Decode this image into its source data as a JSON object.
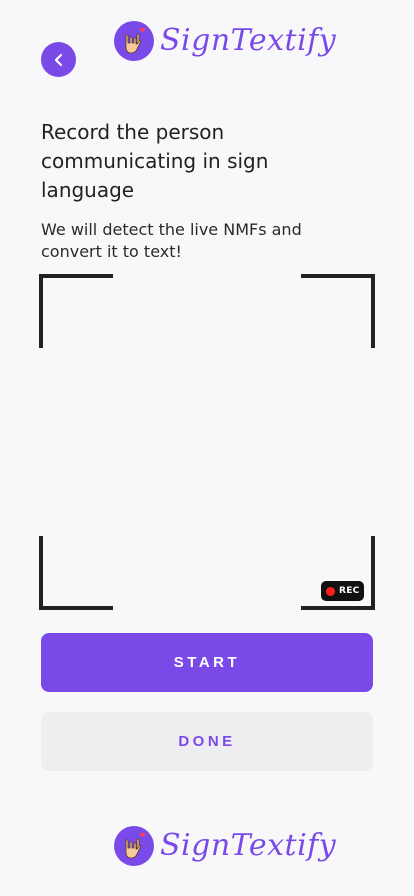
{
  "header": {
    "app_name": "SignTextify",
    "back_icon": "chevron-left-icon",
    "logo_icon": "hand-sign-icon"
  },
  "main": {
    "title": "Record the person communicating in sign language",
    "subtitle": "We will detect the live NMFs and convert it to text!",
    "recording_badge": "REC"
  },
  "actions": {
    "start_label": "START",
    "done_label": "DONE"
  },
  "footer": {
    "app_name": "SignTextify"
  },
  "colors": {
    "accent": "#7a4ae8",
    "record_dot": "#ff1e1e",
    "secondary_button_bg": "#eeeef0",
    "background": "#f8f8fb"
  }
}
